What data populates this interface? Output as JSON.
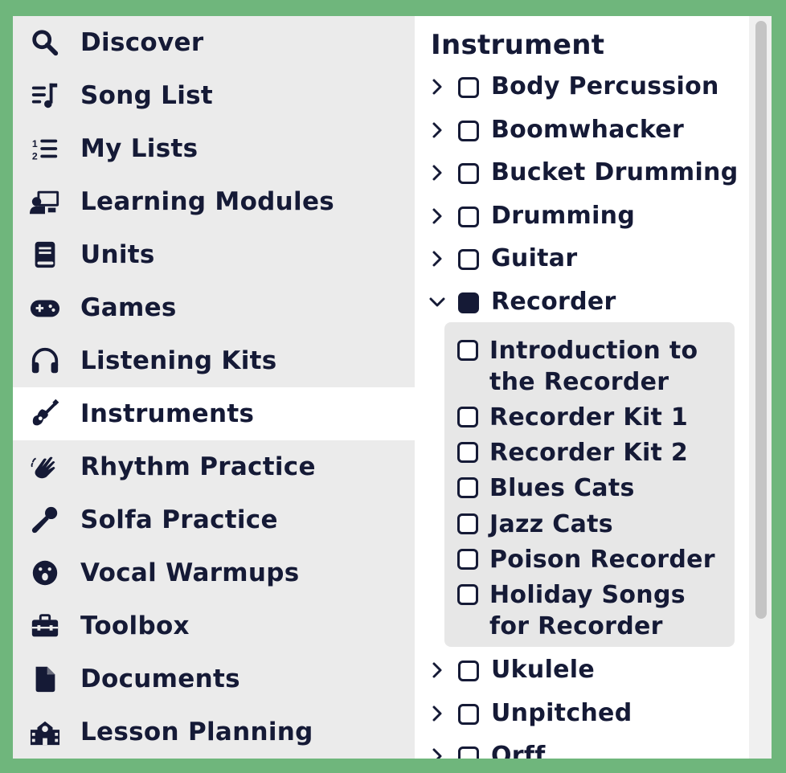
{
  "sidebar": {
    "items": [
      {
        "label": "Discover",
        "icon": "search-icon"
      },
      {
        "label": "Song List",
        "icon": "music-list-icon"
      },
      {
        "label": "My Lists",
        "icon": "numbered-list-icon"
      },
      {
        "label": "Learning Modules",
        "icon": "teacher-board-icon"
      },
      {
        "label": "Units",
        "icon": "book-icon"
      },
      {
        "label": "Games",
        "icon": "gamepad-icon"
      },
      {
        "label": "Listening Kits",
        "icon": "headphones-icon"
      },
      {
        "label": "Instruments",
        "icon": "guitar-icon",
        "active": true
      },
      {
        "label": "Rhythm Practice",
        "icon": "clapping-hands-icon"
      },
      {
        "label": "Solfa Practice",
        "icon": "microphone-icon"
      },
      {
        "label": "Vocal Warmups",
        "icon": "singing-face-icon"
      },
      {
        "label": "Toolbox",
        "icon": "toolbox-icon"
      },
      {
        "label": "Documents",
        "icon": "document-icon"
      },
      {
        "label": "Lesson Planning",
        "icon": "school-icon"
      }
    ]
  },
  "panel": {
    "title": "Instrument",
    "items": [
      {
        "label": "Body Percussion",
        "expanded": false,
        "checked": false
      },
      {
        "label": "Boomwhacker",
        "expanded": false,
        "checked": false
      },
      {
        "label": "Bucket Drumming",
        "expanded": false,
        "checked": false
      },
      {
        "label": "Drumming",
        "expanded": false,
        "checked": false
      },
      {
        "label": "Guitar",
        "expanded": false,
        "checked": false
      },
      {
        "label": "Recorder",
        "expanded": true,
        "checked": true
      },
      {
        "label": "Ukulele",
        "expanded": false,
        "checked": false
      },
      {
        "label": "Unpitched",
        "expanded": false,
        "checked": false
      },
      {
        "label": "Orff",
        "expanded": false,
        "checked": false
      }
    ],
    "recorder_children": [
      {
        "label": "Introduction to the Recorder",
        "checked": false
      },
      {
        "label": "Recorder Kit 1",
        "checked": false
      },
      {
        "label": "Recorder Kit 2",
        "checked": false
      },
      {
        "label": "Blues Cats",
        "checked": false
      },
      {
        "label": "Jazz Cats",
        "checked": false
      },
      {
        "label": "Poison Recorder",
        "checked": false
      },
      {
        "label": "Holiday Songs for Recorder",
        "checked": false
      }
    ]
  },
  "colors": {
    "background_green": "#6fb67c",
    "sidebar_bg": "#ebebeb",
    "active_bg": "#ffffff",
    "text_navy": "#151a36",
    "subgroup_bg": "#e7e7e7"
  }
}
